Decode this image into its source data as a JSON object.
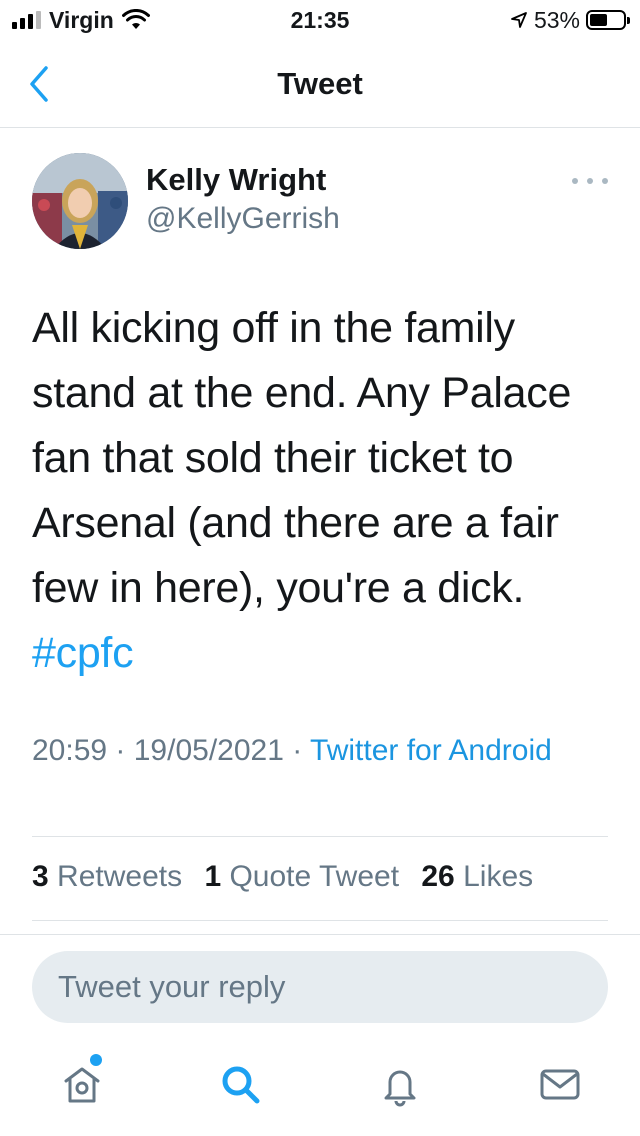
{
  "status_bar": {
    "carrier": "Virgin",
    "time": "21:35",
    "battery": "53%",
    "battery_level": 0.53
  },
  "nav": {
    "title": "Tweet",
    "back_icon": "chevron-left-icon"
  },
  "tweet": {
    "author_name": "Kelly Wright",
    "author_handle": "@KellyGerrish",
    "text": "All kicking off in the family stand at the end. Any Palace fan that sold their ticket to Arsenal (and there are a fair few in here), you're a dick.",
    "hashtag": "#cpfc",
    "time": "20:59",
    "separator": " · ",
    "date": "19/05/2021",
    "source": "Twitter for Android"
  },
  "stats": {
    "retweets_count": "3",
    "retweets_label": "Retweets",
    "quotes_count": "1",
    "quotes_label": "Quote Tweet",
    "likes_count": "26",
    "likes_label": "Likes"
  },
  "reply": {
    "placeholder": "Tweet your reply"
  },
  "tabbar": {
    "items": [
      "home-icon",
      "search-icon",
      "notifications-icon",
      "messages-icon"
    ]
  },
  "colors": {
    "accent": "#1da1f2",
    "text": "#14171a",
    "secondary": "#657786"
  }
}
